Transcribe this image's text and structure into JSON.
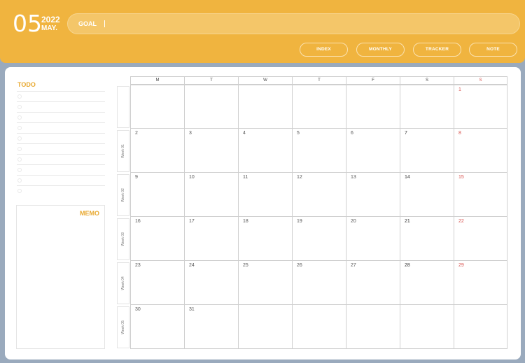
{
  "header": {
    "month_number": "05",
    "year": "2022",
    "month_abbr": "MAY.",
    "goal_label": "GOAL",
    "nav": [
      "INDEX",
      "MONTHLY",
      "TRACKER",
      "NOTE"
    ]
  },
  "sidebar": {
    "todo_title": "TODO",
    "todo_count": 10,
    "memo_title": "MEMO"
  },
  "calendar": {
    "day_headers": [
      "M",
      "T",
      "W",
      "T",
      "F",
      "S",
      "S"
    ],
    "week_labels": [
      "",
      "Week 01",
      "Week 02",
      "Week 03",
      "Week 04",
      "Week 05"
    ],
    "weeks": [
      [
        "",
        "",
        "",
        "",
        "",
        "",
        "1"
      ],
      [
        "2",
        "3",
        "4",
        "5",
        "6",
        "7",
        "8"
      ],
      [
        "9",
        "10",
        "11",
        "12",
        "13",
        "14",
        "15"
      ],
      [
        "16",
        "17",
        "18",
        "19",
        "20",
        "21",
        "22"
      ],
      [
        "23",
        "24",
        "25",
        "26",
        "27",
        "28",
        "29"
      ],
      [
        "30",
        "31",
        "",
        "",
        "",
        "",
        ""
      ]
    ]
  },
  "colors": {
    "accent": "#f0b43f",
    "background": "#9aaabd",
    "sunday": "#d9534f"
  }
}
